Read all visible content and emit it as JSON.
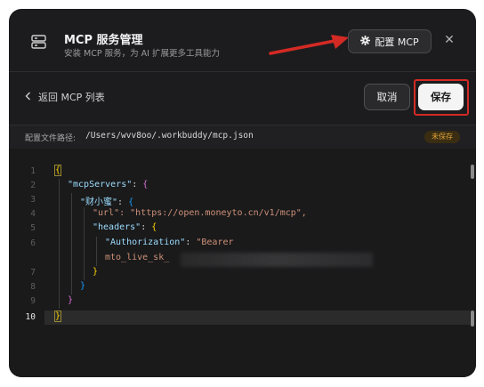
{
  "header": {
    "title": "MCP 服务管理",
    "subtitle": "安装 MCP 服务，为 AI 扩展更多工具能力",
    "config_button_label": "配置 MCP",
    "config_icon": "gear-icon",
    "close_icon": "close-icon"
  },
  "toolbar": {
    "back_label": "返回 MCP 列表",
    "cancel_label": "取消",
    "save_label": "保存"
  },
  "file": {
    "path_label": "配置文件路径:",
    "path_value": "/Users/wvv8oo/.workbuddy/mcp.json",
    "status_badge": "未保存"
  },
  "editor": {
    "line_numbers": [
      "1",
      "2",
      "3",
      "4",
      "5",
      "6",
      "",
      "7",
      "8",
      "9",
      "10"
    ],
    "active_line": "10",
    "lines": [
      "{",
      "\"mcpServers\": {",
      "\"财小蜜\": {",
      "\"url\": \"https://open.moneyto.cn/v1/mcp\",",
      "\"headers\": {",
      "\"Authorization\": \"Bearer",
      "mto_live_sk_",
      "}",
      "}",
      "}",
      "}"
    ]
  },
  "colors": {
    "annotation_red": "#d42a24",
    "dialog_bg": "#1c1c1e",
    "badge_text": "#e0a43a"
  }
}
